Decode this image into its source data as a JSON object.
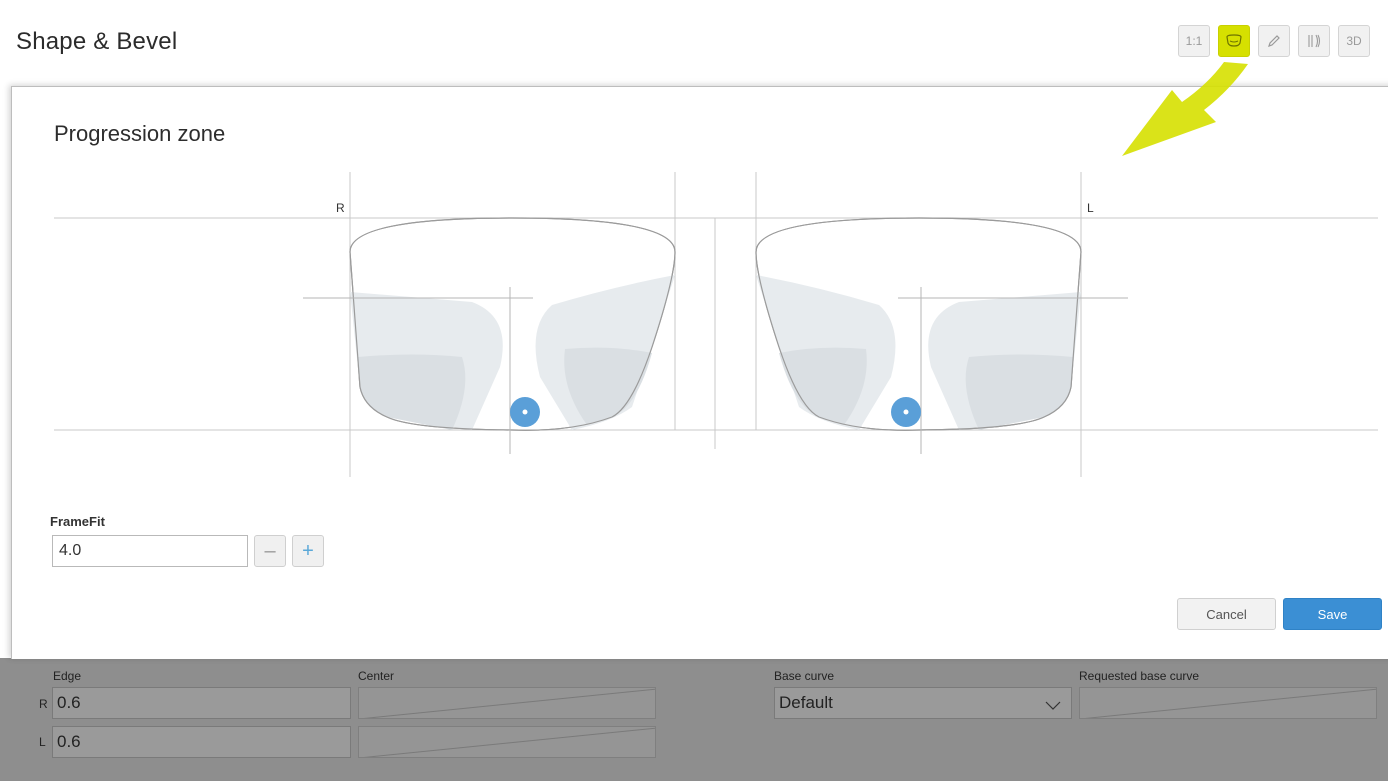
{
  "app": {
    "title": "Shape & Bevel"
  },
  "toolbar": {
    "scale_label": "1:1",
    "frame_icon": "frame-shape-icon",
    "edit_icon": "pencil-icon",
    "bevel_icon": "bevel-profile-icon",
    "three_d_label": "3D",
    "active_color": "#d6e000"
  },
  "dialog": {
    "title": "Progression zone",
    "right_label": "R",
    "left_label": "L",
    "framefit": {
      "label": "FrameFit",
      "value": "4.0"
    },
    "cancel_label": "Cancel",
    "save_label": "Save",
    "save_color": "#3b8fd4"
  },
  "thickness": {
    "edge_label": "Edge",
    "center_label": "Center",
    "base_curve_label": "Base curve",
    "requested_base_curve_label": "Requested base curve",
    "row_r": "R",
    "row_l": "L",
    "edge_r": "0.6",
    "edge_l": "0.6",
    "base_curve_value": "Default"
  },
  "annotation": {
    "arrow_color": "#d6e000"
  }
}
